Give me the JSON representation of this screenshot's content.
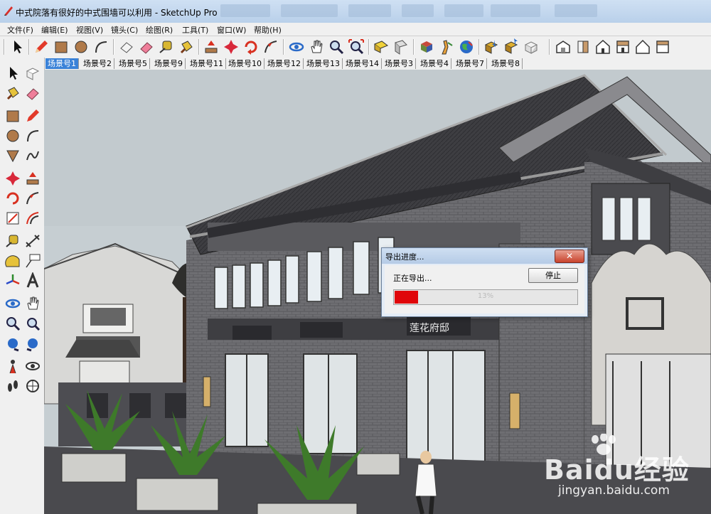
{
  "window": {
    "title": "中式院落有很好的中式围墙可以利用 - SketchUp Pro"
  },
  "menu": [
    "文件(F)",
    "编辑(E)",
    "视图(V)",
    "镜头(C)",
    "绘图(R)",
    "工具(T)",
    "窗口(W)",
    "帮助(H)"
  ],
  "scenes": [
    "场景号1",
    "场景号2",
    "场景号5",
    "场景号9",
    "场景号11",
    "场景号10",
    "场景号12",
    "场景号13",
    "场景号14",
    "场景号3",
    "场景号4",
    "场景号7",
    "场景号8"
  ],
  "active_scene": "场景号1",
  "toolbar_icons": [
    "select-icon",
    "pencil-icon",
    "rectangle-icon",
    "circle-icon",
    "arc-icon",
    "eraser-icon",
    "eraser-pink-icon",
    "tape-measure-icon",
    "paint-bucket-icon",
    "push-pull-icon",
    "move-icon",
    "rotate-icon",
    "follow-me-icon",
    "orbit-icon",
    "pan-icon",
    "zoom-icon",
    "zoom-extents-icon",
    "section-icon",
    "section-plane-icon",
    "component-icon",
    "walk-icon",
    "earth-icon",
    "import-icon",
    "export-icon",
    "warehouse-icon",
    "iso-view-icon",
    "front-view-icon",
    "top-view-icon",
    "right-view-icon",
    "back-view-icon",
    "left-view-icon"
  ],
  "dialog": {
    "title": "导出进度...",
    "close": "✕",
    "label": "正在导出...",
    "stop_button": "停止",
    "progress_percent": 13,
    "progress_text": "13%"
  },
  "viewport": {
    "signs": [
      "莲花府邸"
    ]
  },
  "watermark": {
    "main": "Baidu经验",
    "sub": "jingyan.baidu.com"
  },
  "colors": {
    "progress": "#e0060a",
    "scene_active": "#3a82d8"
  }
}
